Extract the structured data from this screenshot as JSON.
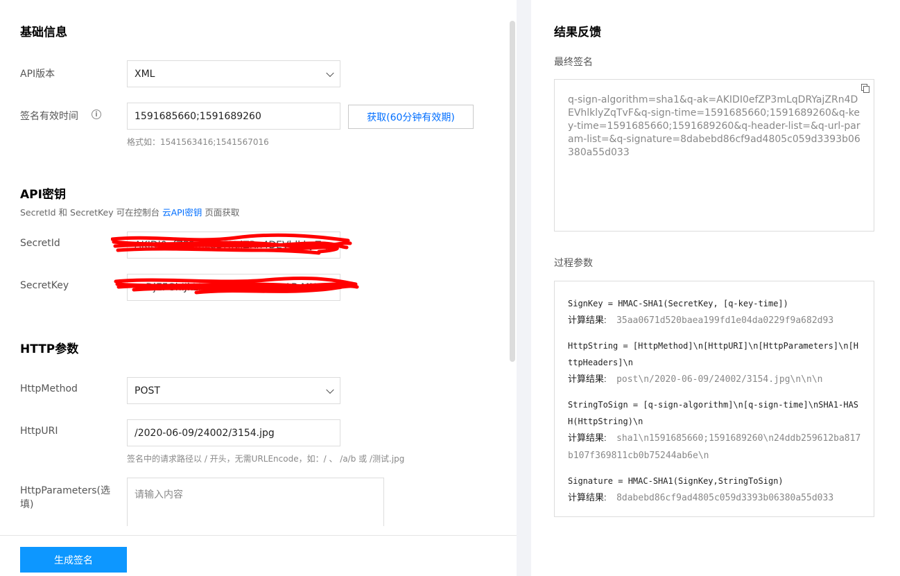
{
  "basic": {
    "title": "基础信息",
    "api_version_label": "API版本",
    "api_version_value": "XML",
    "sign_time_label": "签名有效时间",
    "sign_time_value": "1591685660;1591689260",
    "get_button": "获取(60分钟有效期)",
    "format_hint": "格式如：1541563416;1541567016"
  },
  "api_key": {
    "title": "API密钥",
    "desc_prefix": "SecretId 和 SecretKey 可在控制台 ",
    "desc_link": "云API密钥",
    "desc_suffix": " 页面获取",
    "secret_id_label": "SecretId",
    "secret_id_value": "AKIDI0efZP3mLqDRYajZRn4DEVhlkl yZq",
    "secret_key_label": "SecretKey",
    "secret_key_value": "acDjEFGhIJkLMNopQRstuvW yzAB MNu"
  },
  "http": {
    "title": "HTTP参数",
    "method_label": "HttpMethod",
    "method_value": "POST",
    "uri_label": "HttpURI",
    "uri_value": "/2020-06-09/24002/3154.jpg",
    "uri_hint": "签名中的请求路径以 / 开头，无需URLEncode，如：/ 、 /a/b 或 /测试.jpg",
    "params_label": "HttpParameters(选填)",
    "params_placeholder": "请输入内容"
  },
  "footer": {
    "generate_button": "生成签名"
  },
  "result": {
    "title": "结果反馈",
    "final_sig_label": "最终签名",
    "final_sig": "q-sign-algorithm=sha1&q-ak=AKIDI0efZP3mLqDRYajZRn4DEVhlklyZqTvF&q-sign-time=1591685660;1591689260&q-key-time=1591685660;1591689260&q-header-list=&q-url-param-list=&q-signature=8dabebd86cf9ad4805c059d3393b06380a55d033",
    "process_label": "过程参数",
    "result_word": "计算结果:",
    "sign_key_formula": "SignKey = HMAC-SHA1(SecretKey, [q-key-time])",
    "sign_key_result": "35aa0671d520baea199fd1e04da0229f9a682d93",
    "http_string_formula": "HttpString = [HttpMethod]\\n[HttpURI]\\n[HttpParameters]\\n[HttpHeaders]\\n",
    "http_string_result": "post\\n/2020-06-09/24002/3154.jpg\\n\\n\\n",
    "string_to_sign_formula": "StringToSign = [q-sign-algorithm]\\n[q-sign-time]\\nSHA1-HASH(HttpString)\\n",
    "string_to_sign_result": "sha1\\n1591685660;1591689260\\n24ddb259612ba817b107f369811cb0b75244ab6e\\n",
    "signature_formula": "Signature = HMAC-SHA1(SignKey,StringToSign)",
    "signature_result": "8dabebd86cf9ad4805c059d3393b06380a55d033"
  }
}
